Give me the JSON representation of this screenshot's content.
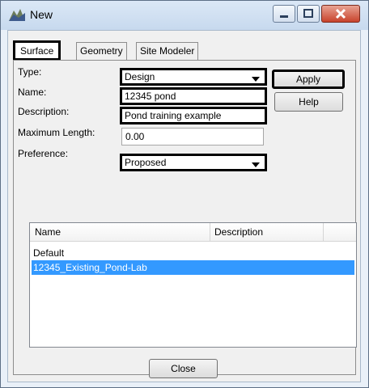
{
  "window": {
    "title": "New",
    "icon": "app-surface-icon"
  },
  "tabs": [
    {
      "label": "Surface",
      "active": true
    },
    {
      "label": "Geometry",
      "active": false
    },
    {
      "label": "Site Modeler",
      "active": false
    }
  ],
  "form": {
    "type_label": "Type:",
    "type_value": "Design",
    "name_label": "Name:",
    "name_value": "12345 pond",
    "description_label": "Description:",
    "description_value": "Pond training example",
    "max_length_label": "Maximum Length:",
    "max_length_value": "0.00",
    "preference_label": "Preference:",
    "preference_value": "Proposed"
  },
  "buttons": {
    "apply": "Apply",
    "help": "Help",
    "close": "Close"
  },
  "list": {
    "columns": [
      "Name",
      "Description"
    ],
    "rows": [
      {
        "name": "Default",
        "selected": false
      },
      {
        "name": "12345_Existing_Pond-Lab",
        "selected": true
      }
    ]
  },
  "colors": {
    "selection": "#3399ff",
    "highlight_border": "#000000"
  }
}
